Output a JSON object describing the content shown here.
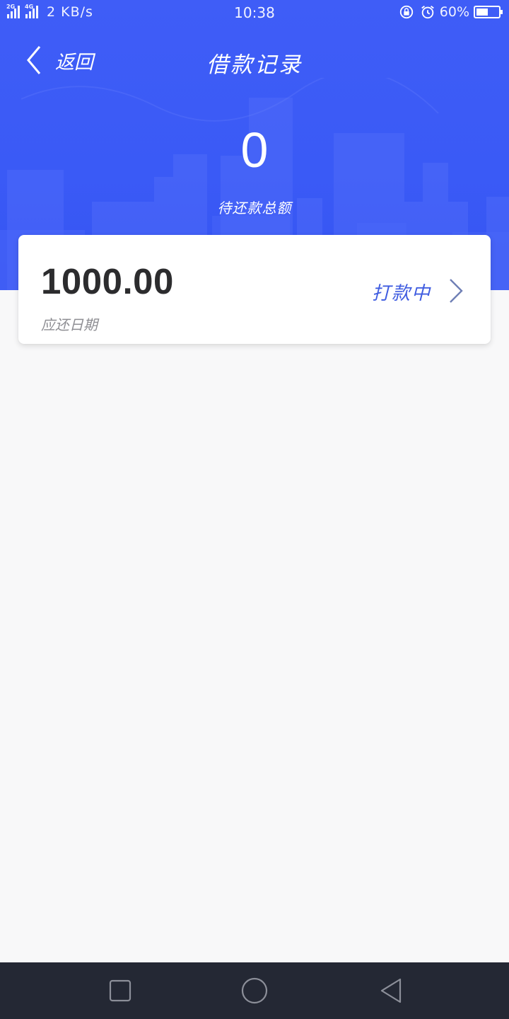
{
  "status_bar": {
    "net_tag_1": "2G",
    "net_tag_2": "4G",
    "speed": "2 KB/s",
    "time": "10:38",
    "battery_percent": "60%",
    "battery_level": 0.6,
    "icons": [
      "signal-icon",
      "signal-icon",
      "rotation-lock-icon",
      "alarm-icon",
      "battery-icon"
    ]
  },
  "nav": {
    "back_label": "返回",
    "title": "借款记录"
  },
  "summary": {
    "amount": "0",
    "label": "待还款总额"
  },
  "loans": [
    {
      "amount": "1000.00",
      "due_label": "应还日期",
      "status": "打款中"
    }
  ],
  "colors": {
    "header_blue": "#3f5df7",
    "status_text": "#3f5ce0",
    "page_bg": "#f8f8f9",
    "nav_bar": "#242834"
  }
}
